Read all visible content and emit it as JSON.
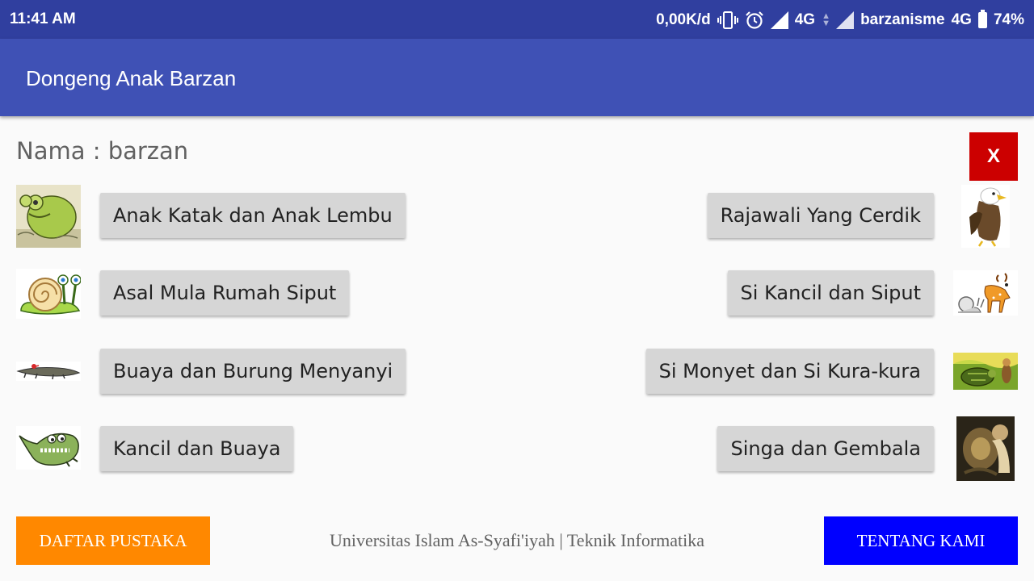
{
  "status": {
    "time": "11:41 AM",
    "speed": "0,00K/d",
    "net1": "4G",
    "carrier": "barzanisme",
    "net2": "4G",
    "battery": "74%"
  },
  "app": {
    "title": "Dongeng Anak Barzan"
  },
  "user": {
    "name_label": "Nama : barzan"
  },
  "close_label": "X",
  "stories": {
    "left": [
      {
        "label": "Anak Katak dan Anak Lembu",
        "icon": "frog-icon"
      },
      {
        "label": "Asal Mula Rumah Siput",
        "icon": "snail-icon"
      },
      {
        "label": "Buaya dan Burung Menyanyi",
        "icon": "crocodile-icon"
      },
      {
        "label": "Kancil dan Buaya",
        "icon": "crocodile-cartoon-icon"
      }
    ],
    "right": [
      {
        "label": "Rajawali Yang Cerdik",
        "icon": "eagle-icon"
      },
      {
        "label": "Si Kancil dan Siput",
        "icon": "deer-snail-icon"
      },
      {
        "label": "Si Monyet dan Si Kura-kura",
        "icon": "monkey-turtle-icon"
      },
      {
        "label": "Singa dan Gembala",
        "icon": "lion-shepherd-icon"
      }
    ]
  },
  "footer": {
    "references_label": "DAFTAR PUSTAKA",
    "credit": "Universitas Islam As-Syafi'iyah | Teknik Informatika",
    "about_label": "TENTANG KAMI"
  },
  "colors": {
    "status_bar": "#303f9f",
    "app_bar": "#3f51b5",
    "close_button": "#cc0000",
    "references_button": "#ff8800",
    "about_button": "#0000ff"
  }
}
